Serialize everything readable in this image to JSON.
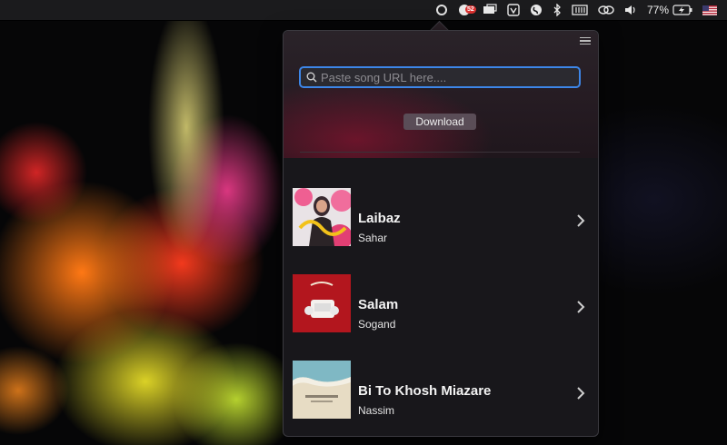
{
  "menubar": {
    "icons": [
      "status-ring-icon",
      "notification-badge-icon",
      "display-icon",
      "shield-icon",
      "shazam-icon",
      "bluetooth-icon",
      "battery-grid-icon",
      "link-icon",
      "volume-icon",
      "battery-icon",
      "us-flag-icon"
    ],
    "badge_count": "52",
    "battery_percent": "77%"
  },
  "popover": {
    "menu_icon": "hamburger-icon",
    "search": {
      "placeholder": "Paste song URL here....",
      "value": ""
    },
    "download_label": "Download",
    "songs": [
      {
        "title": "Laibaz",
        "artist": "Sahar",
        "cover_color": "#e24c84"
      },
      {
        "title": "Salam",
        "artist": "Sogand",
        "cover_color": "#b3161e"
      },
      {
        "title": "Bi To Khosh Miazare",
        "artist": "Nassim",
        "cover_color": "#cfc4a3"
      }
    ]
  },
  "colors": {
    "accent_focus": "#3d86e8",
    "popover_bg": "#18171b",
    "button_bg": "#5a4d57"
  }
}
